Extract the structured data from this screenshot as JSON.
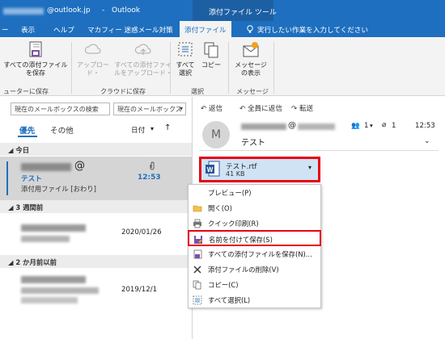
{
  "titlebar": {
    "account": "@outlook.jp",
    "separator": "-",
    "app": "Outlook",
    "tool_label": "添付ファイル ツール"
  },
  "tabs": [
    {
      "label": "ー"
    },
    {
      "label": "表示"
    },
    {
      "label": "ヘルプ"
    },
    {
      "label": "マカフィー 迷惑メール対策"
    },
    {
      "label": "添付ファイル"
    },
    {
      "label": "実行したい作業を入力してください"
    }
  ],
  "ribbon": {
    "save_all": "すべての添付ファイル\nを保存",
    "upload": "アップロー\nド・",
    "upload_all": "すべての添付ファイ\nルをアップロード・",
    "select_all": "すべて\n選択",
    "copy": "コピー",
    "show_message": "メッセージ\nの表示",
    "group_save": "ューターに保存",
    "group_cloud": "クラウドに保存",
    "group_select": "選択",
    "group_message": "メッセージ"
  },
  "left": {
    "search_placeholder": "現在のメールボックスの検索",
    "scope": "現在のメールボックス",
    "focused_tab": "優先",
    "other_tab": "その他",
    "sort_label": "日付",
    "groups": {
      "today": "今日",
      "weeks3": "3 週間前",
      "months2": "2 か月前以前"
    },
    "mails": [
      {
        "sender_suffix": "@",
        "subject": "テスト",
        "preview": "添付用ファイル [おわり]",
        "time": "12:53"
      },
      {
        "date": "2020/01/26"
      },
      {
        "date": "2019/12/1"
      }
    ]
  },
  "reading": {
    "reply": "返信",
    "reply_all": "全員に返信",
    "forward": "転送",
    "avatar_letter": "M",
    "sender_suffix": "@",
    "people_count": "1",
    "attach_count": "1",
    "time": "12:53",
    "subject": "テスト",
    "attachment": {
      "name": "テスト.rtf",
      "size": "41 KB"
    }
  },
  "context_menu": [
    {
      "label": "プレビュー(P)",
      "icon": "preview-icon"
    },
    {
      "label": "開く(O)",
      "icon": "open-folder-icon"
    },
    {
      "label": "クイック印刷(R)",
      "icon": "print-icon"
    },
    {
      "label": "名前を付けて保存(S)",
      "icon": "save-as-icon"
    },
    {
      "label": "すべての添付ファイルを保存(N)...",
      "icon": "save-all-icon"
    },
    {
      "label": "添付ファイルの削除(V)",
      "icon": "delete-x-icon"
    },
    {
      "label": "コピー(C)",
      "icon": "copy-icon"
    },
    {
      "label": "すべて選択(L)",
      "icon": "select-all-icon"
    }
  ],
  "colors": {
    "accent": "#1e6fbf",
    "highlight": "#e60012",
    "attach_bg": "#cfe3f5"
  }
}
